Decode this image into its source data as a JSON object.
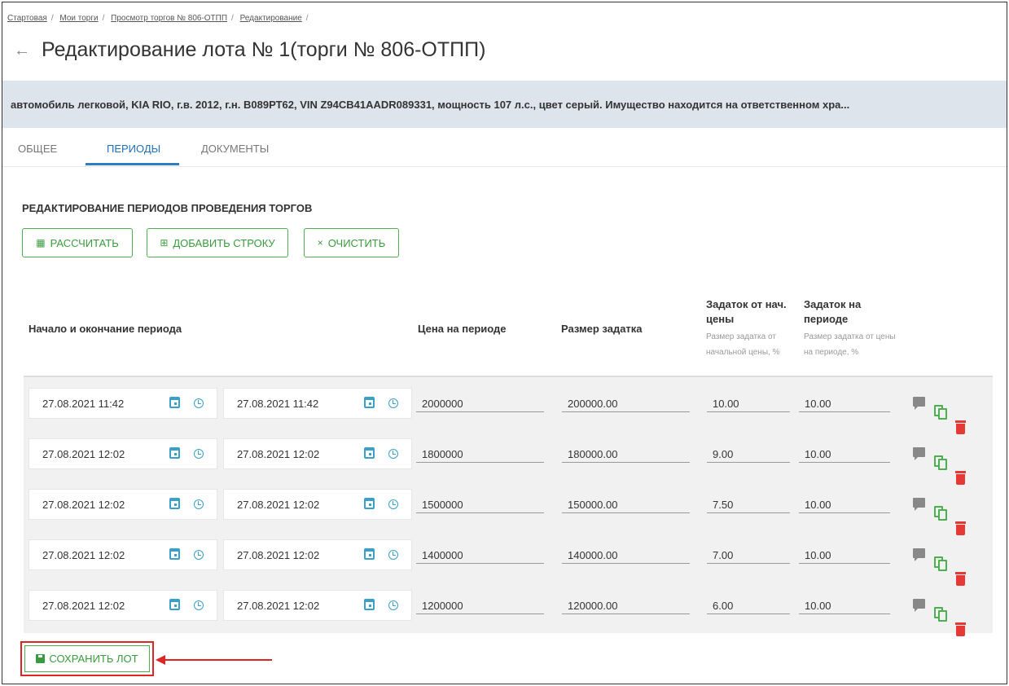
{
  "breadcrumb": [
    "Стартовая",
    "Мои торги",
    "Просмотр торгов № 806-ОТПП",
    "Редактирование"
  ],
  "page_title": "Редактирование лота № 1(торги № 806-ОТПП)",
  "lot_description": "автомобиль легковой, KIA RIO, г.в. 2012, г.н. В089РТ62, VIN Z94CB41AADR089331, мощность 107 л.с., цвет серый. Имущество находится на ответственном хра...",
  "tabs": [
    {
      "label": "ОБЩЕЕ",
      "active": false
    },
    {
      "label": "ПЕРИОДЫ",
      "active": true
    },
    {
      "label": "ДОКУМЕНТЫ",
      "active": false
    }
  ],
  "section_title": "РЕДАКТИРОВАНИЕ ПЕРИОДОВ ПРОВЕДЕНИЯ ТОРГОВ",
  "toolbar": {
    "calculate_label": "РАССЧИТАТЬ",
    "add_row_label": "ДОБАВИТЬ СТРОКУ",
    "clear_label": "ОЧИСТИТЬ"
  },
  "columns": {
    "period": "Начало и окончание периода",
    "price": "Цена на периоде",
    "deposit": "Размер задатка",
    "deposit_start_pct": "Задаток от нач. цены",
    "deposit_start_pct_sub": "Размер задатка от начальной цены, %",
    "deposit_period_pct": "Задаток на периоде",
    "deposit_period_pct_sub": "Размер задатка от цены на периоде, %"
  },
  "rows": [
    {
      "start": "27.08.2021 11:42",
      "end": "27.08.2021 11:42",
      "price": "2000000",
      "deposit": "200000.00",
      "pct_start": "10.00",
      "pct_period": "10.00"
    },
    {
      "start": "27.08.2021 12:02",
      "end": "27.08.2021 12:02",
      "price": "1800000",
      "deposit": "180000.00",
      "pct_start": "9.00",
      "pct_period": "10.00"
    },
    {
      "start": "27.08.2021 12:02",
      "end": "27.08.2021 12:02",
      "price": "1500000",
      "deposit": "150000.00",
      "pct_start": "7.50",
      "pct_period": "10.00"
    },
    {
      "start": "27.08.2021 12:02",
      "end": "27.08.2021 12:02",
      "price": "1400000",
      "deposit": "140000.00",
      "pct_start": "7.00",
      "pct_period": "10.00"
    },
    {
      "start": "27.08.2021 12:02",
      "end": "27.08.2021 12:02",
      "price": "1200000",
      "deposit": "120000.00",
      "pct_start": "6.00",
      "pct_period": "10.00"
    }
  ],
  "save_label": "СОХРАНИТЬ ЛОТ",
  "colors": {
    "accent": "#2f7cc0",
    "green": "#4caf50",
    "red": "#e53935",
    "banner": "#dde4ec"
  }
}
